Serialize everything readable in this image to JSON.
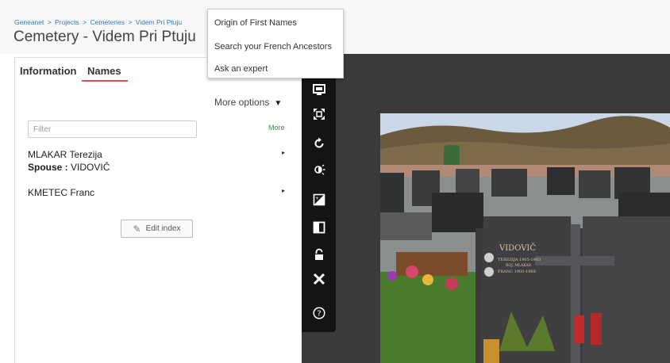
{
  "header": {
    "breadcrumb": [
      "Geneanet",
      "Projects",
      "Cemeteries",
      "Videm Pri Ptuju"
    ],
    "breadcrumb_separator": ">",
    "title": "Cemetery - Videm Pri Ptuju"
  },
  "tabs": [
    {
      "label": "Information",
      "active": false
    },
    {
      "label": "Names",
      "active": true
    }
  ],
  "more_options": {
    "label": "More options",
    "caret": "▼"
  },
  "filter": {
    "placeholder": "Filter",
    "value": ""
  },
  "more_link": "More",
  "entries": [
    {
      "name": "MLAKAR Terezija",
      "spouse_label": "Spouse :",
      "spouse_value": "VIDOVIČ",
      "arrow": "▸"
    },
    {
      "name": "KMETEC Franc",
      "arrow": "▸"
    }
  ],
  "edit_index_label": "Edit index",
  "dropdown": {
    "items": [
      "Origin of First Names",
      "Search your French Ancestors",
      "Ask an expert"
    ]
  },
  "toolbar": {
    "icons": [
      "monitor-icon",
      "fullscreen-icon",
      "rotate-icon",
      "brightness-icon",
      "contrast-icon",
      "invert-icon",
      "lock-icon",
      "close-icon",
      "help-icon"
    ]
  },
  "photo": {
    "headstone_name": "VIDOVIČ",
    "headstone_line1": "TEREZIJA 1905-1983",
    "headstone_line2": "ROJ. MLAKAR",
    "headstone_line3": "FRANC 1903-1988",
    "colors": {
      "sky": "#c9d7e6",
      "hill": "#6b5b3e",
      "granite": "#3a3a3c",
      "grass": "#4a7a2c"
    }
  },
  "colors": {
    "link": "#2d7cc0",
    "accent": "#e0504a",
    "more_link": "#3a8f3a",
    "viewer_bg": "#3c3a39",
    "toolbar_bg": "#141414"
  }
}
